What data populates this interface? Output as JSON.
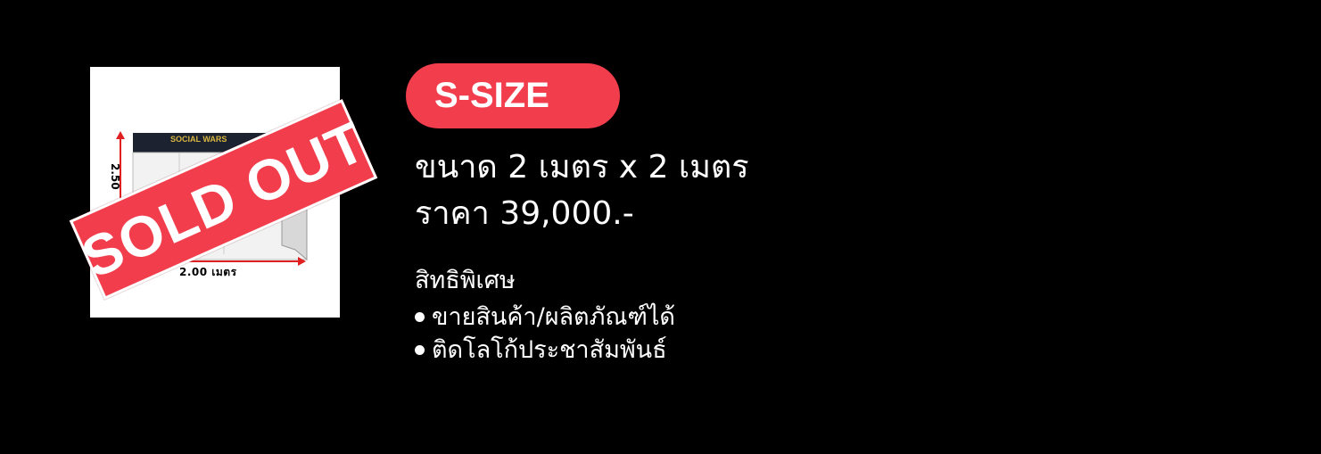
{
  "booth_image": {
    "sign_text": "SOCIAL WARS",
    "width_label": "2.00 เมตร",
    "height_label": "2.50",
    "sold_out": "SOLD OUT"
  },
  "package": {
    "size_label": "S-SIZE",
    "dimensions": "ขนาด 2 เมตร x 2 เมตร",
    "price": "ราคา 39,000.-",
    "benefits_title": "สิทธิพิเศษ",
    "benefits": [
      "ขายสินค้า/ผลิตภัณฑ์ได้",
      "ติดโลโก้ประชาสัมพันธ์"
    ]
  },
  "colors": {
    "background": "#000000",
    "accent": "#f23d4c",
    "text": "#ffffff"
  }
}
